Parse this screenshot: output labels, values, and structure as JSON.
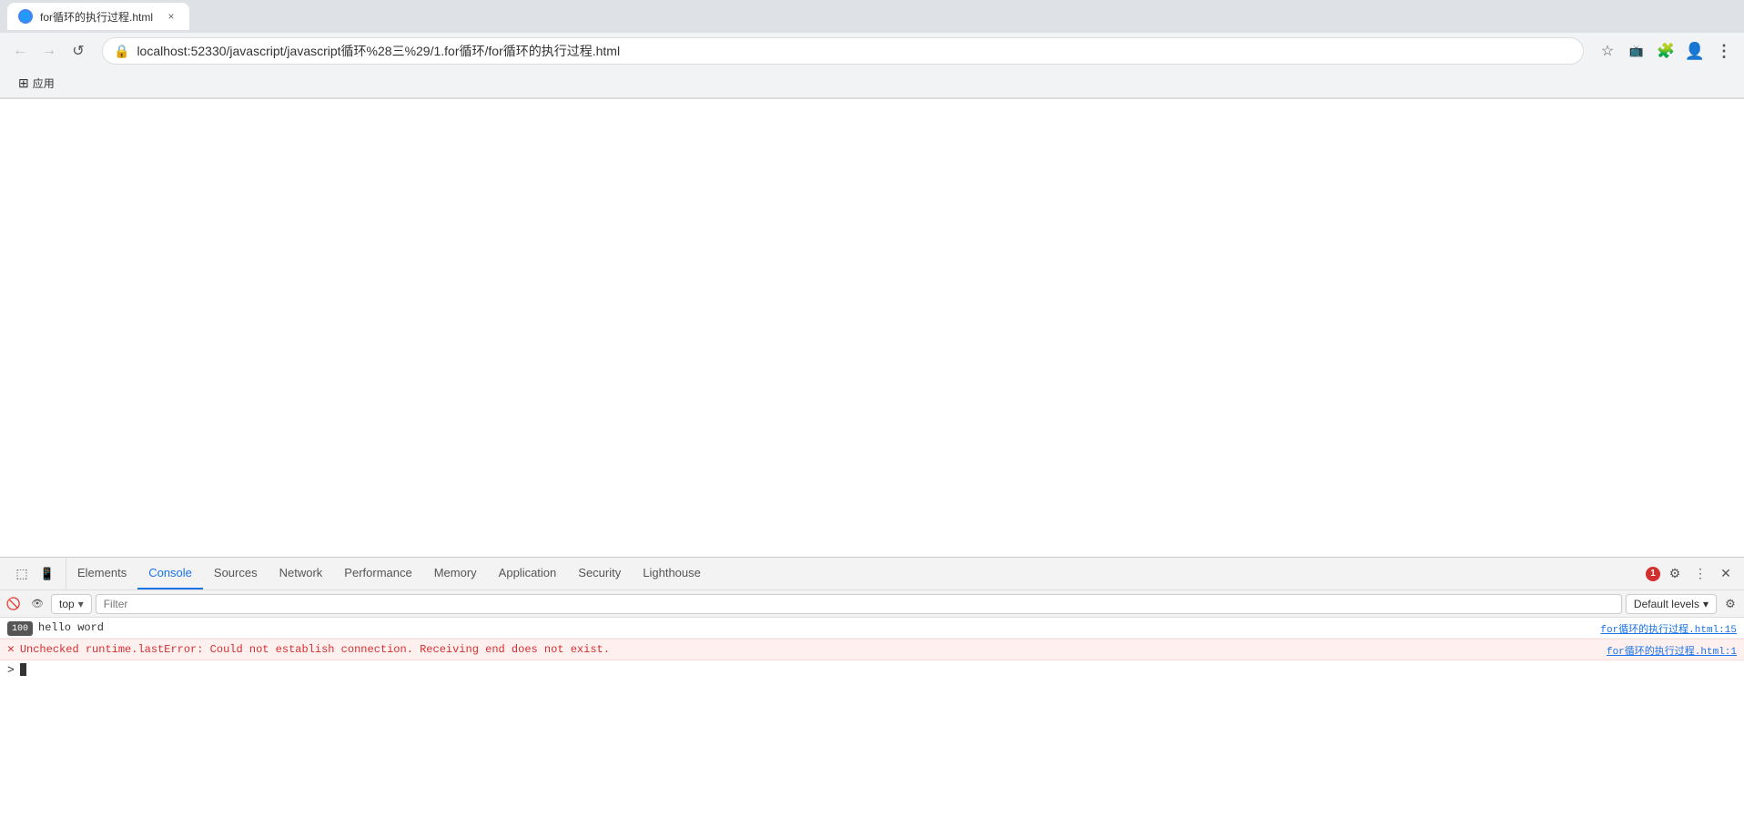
{
  "browser": {
    "tab": {
      "title": "for循环的执行过程.html"
    },
    "address": {
      "url": "localhost:52330/javascript/javascript循环%28三%29/1.for循环/for循环的执行过程.html",
      "security_icon": "🔒"
    },
    "bookmarks": [
      {
        "label": "应用",
        "icon": "⊞"
      }
    ]
  },
  "devtools": {
    "tabs": [
      {
        "id": "elements",
        "label": "Elements",
        "active": false
      },
      {
        "id": "console",
        "label": "Console",
        "active": true
      },
      {
        "id": "sources",
        "label": "Sources",
        "active": false
      },
      {
        "id": "network",
        "label": "Network",
        "active": false
      },
      {
        "id": "performance",
        "label": "Performance",
        "active": false
      },
      {
        "id": "memory",
        "label": "Memory",
        "active": false
      },
      {
        "id": "application",
        "label": "Application",
        "active": false
      },
      {
        "id": "security",
        "label": "Security",
        "active": false
      },
      {
        "id": "lighthouse",
        "label": "Lighthouse",
        "active": false
      }
    ],
    "error_count": "1",
    "console": {
      "context": "top",
      "filter_placeholder": "Filter",
      "levels_label": "Default levels",
      "log_entries": [
        {
          "type": "log",
          "badge": "100",
          "text": "hello word",
          "source": "for循环的执行过程.html:15"
        }
      ],
      "error_entries": [
        {
          "type": "error",
          "text": "Unchecked runtime.lastError: Could not establish connection. Receiving end does not exist.",
          "source": "for循环的执行过程.html:1"
        }
      ],
      "input_prompt": ">",
      "input_value": ""
    }
  },
  "icons": {
    "back": "←",
    "forward": "→",
    "reload": "↺",
    "star": "☆",
    "extension": "🧩",
    "profile": "👤",
    "menu": "⋮",
    "clear_console": "🚫",
    "top_level_only": "⊙",
    "create_live": "⊕",
    "settings": "⚙",
    "close": "✕",
    "dock_side": "⊡",
    "more_tabs": "⋮",
    "chevron_down": "▾",
    "error": "✕",
    "inspect": "⬚",
    "device": "📱"
  }
}
